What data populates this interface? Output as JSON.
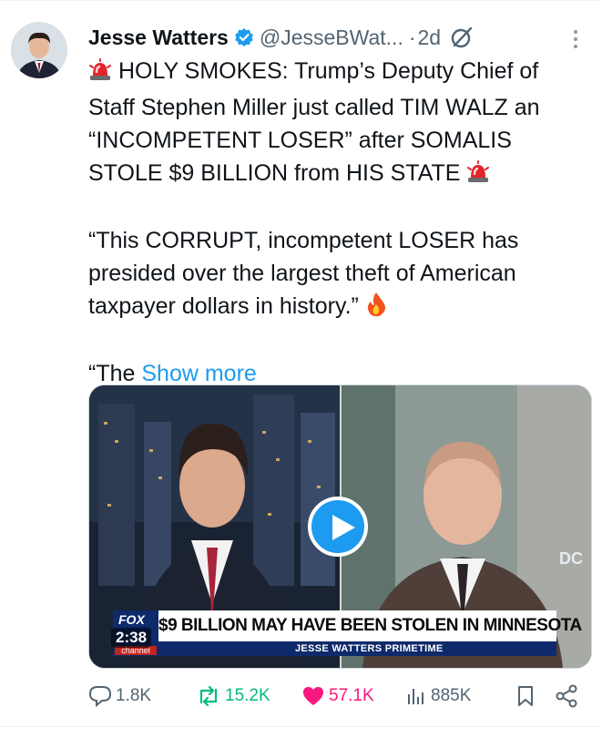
{
  "author": {
    "name": "Jesse Watters",
    "handle": "@JesseBWat...",
    "separator": "·",
    "age": "2d"
  },
  "post": {
    "para1": "HOLY SMOKES: Trump’s Deputy Chief of Staff Stephen Miller just called TIM WALZ an “INCOMPETENT LOSER” after SOMALIS STOLE $9 BILLION from HIS STATE",
    "para2": "“This CORRUPT, incompetent LOSER has presided over the largest theft of American taxpayer dollars in history.”",
    "para3": "“The",
    "show_more": "Show more"
  },
  "media": {
    "network": "FOX",
    "network_sub": "channel",
    "timer": "2:38",
    "headline": "$9 BILLION MAY HAVE BEEN STOLEN IN MINNESOTA",
    "show_name": "JESSE WATTERS PRIMETIME",
    "corner_text": "DC"
  },
  "actions": {
    "replies": "1.8K",
    "reposts": "15.2K",
    "likes": "57.1K",
    "views": "885K"
  },
  "colors": {
    "accent": "#1d9bf0",
    "repost": "#00ba7c",
    "like": "#f91880",
    "muted": "#536471"
  }
}
